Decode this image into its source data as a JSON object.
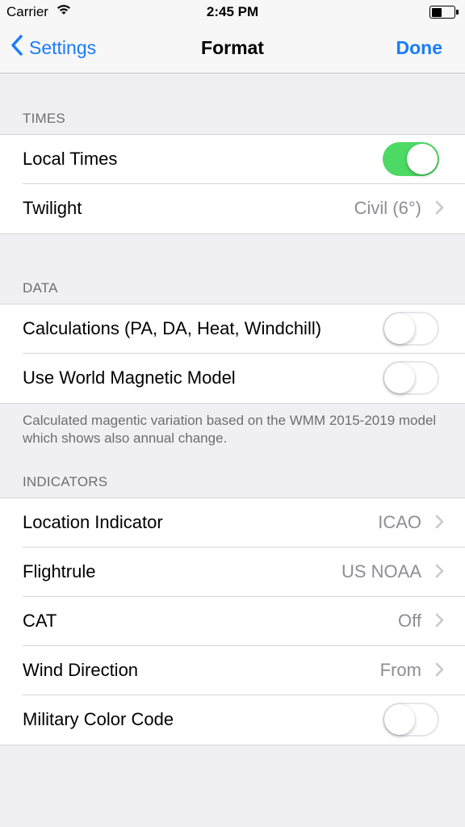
{
  "status_bar": {
    "carrier": "Carrier",
    "time": "2:45 PM"
  },
  "nav": {
    "back_label": "Settings",
    "title": "Format",
    "done_label": "Done"
  },
  "sections": {
    "times": {
      "header": "TIMES",
      "rows": [
        {
          "label": "Local Times",
          "toggle": true
        },
        {
          "label": "Twilight",
          "value": "Civil (6°)"
        }
      ]
    },
    "data": {
      "header": "DATA",
      "rows": [
        {
          "label": "Calculations (PA, DA, Heat, Windchill)",
          "toggle": false
        },
        {
          "label": "Use World Magnetic Model",
          "toggle": false
        }
      ],
      "footer": "Calculated magentic variation based on the WMM 2015-2019 model which shows also annual change."
    },
    "indicators": {
      "header": "INDICATORS",
      "rows": [
        {
          "label": "Location Indicator",
          "value": "ICAO"
        },
        {
          "label": "Flightrule",
          "value": "US NOAA"
        },
        {
          "label": "CAT",
          "value": "Off"
        },
        {
          "label": "Wind Direction",
          "value": "From"
        },
        {
          "label": "Military Color Code",
          "toggle": false
        }
      ]
    }
  },
  "colors": {
    "accent": "#1a7cf9",
    "toggle_on": "#4cd964",
    "background": "#efeff4"
  },
  "icons": {
    "back": "chevron-left-icon",
    "disclosure": "chevron-right-icon",
    "wifi": "wifi-icon",
    "battery": "battery-icon"
  }
}
